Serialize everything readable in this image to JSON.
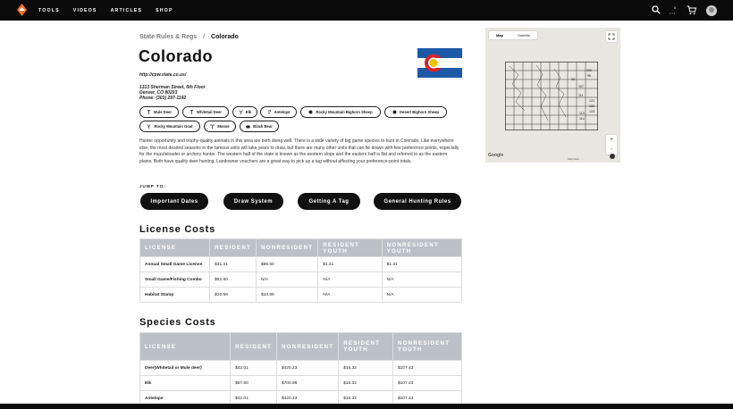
{
  "nav": {
    "links": [
      "TOOLS",
      "VIDEOS",
      "ARTICLES",
      "SHOP"
    ],
    "cart_count": "0",
    "logo": "mountain-logo-icon",
    "search_icon": "search-icon",
    "cart_icon": "cart-icon"
  },
  "breadcrumb": {
    "parent": "State Rules & Regs",
    "separator": "/",
    "current": "Colorado"
  },
  "page_title": "Colorado",
  "site_link": "http://cpw.state.co.us/",
  "address": [
    "1313 Sherman Street, 6th Floor",
    "Denver, CO 80203",
    "Phone: (303) 297-1192"
  ],
  "species_buttons": [
    {
      "label": "Mule Deer",
      "icon": "deer-icon"
    },
    {
      "label": "Whitetail Deer",
      "icon": "deer-icon"
    },
    {
      "label": "Elk",
      "icon": "elk-icon"
    },
    {
      "label": "Antelope",
      "icon": "antelope-icon"
    },
    {
      "label": "Rocky Mountain Bighorn Sheep",
      "icon": "sheep-icon"
    },
    {
      "label": "Desert Bighorn Sheep",
      "icon": "sheep-icon"
    },
    {
      "label": "Rocky Mountain Goat",
      "icon": "goat-icon"
    },
    {
      "label": "Moose",
      "icon": "moose-icon"
    },
    {
      "label": "Black Bear",
      "icon": "bear-icon"
    }
  ],
  "description": "Hunter opportunity and trophy-quality animals in this area are both doing well. There is a wide variety of big game species to hunt in Colorado. Like everywhere else, the most desired seasons in the famous units will take years to draw, but there are many other units that can be drawn with few preference points, especially for the muzzleloader or archery hunter. The western half of the state is known as the western slope and the eastern half is flat and referred to as the eastern plains. Both have quality deer hunting. Landowner vouchers are a great way to pick up a tag without affecting your preference-point totals.",
  "jump": {
    "label": "JUMP TO:",
    "buttons": [
      "Important Dates",
      "Draw System",
      "Getting A Tag",
      "General Hunting Rules"
    ]
  },
  "license_costs": {
    "title": "License Costs",
    "headers": [
      "LICENSE",
      "RESIDENT",
      "NONRESIDENT",
      "RESIDENT YOUTH",
      "NONRESIDENT YOUTH"
    ],
    "rows": [
      [
        "Annual Small Game License",
        "$31.41",
        "$86.50",
        "$1.31",
        "$1.31"
      ],
      [
        "Small Game/Fishing Combo",
        "$52.60",
        "N/A",
        "N/A",
        "N/A"
      ],
      [
        "Habitat Stamp",
        "$10.59",
        "$10.59",
        "N/A",
        "N/A"
      ]
    ]
  },
  "species_costs": {
    "title": "Species Costs",
    "headers": [
      "LICENSE",
      "RESIDENT",
      "NONRESIDENT",
      "RESIDENT YOUTH",
      "NONRESIDENT YOUTH"
    ],
    "rows": [
      [
        "Deer(Whitetail or Mule deer)",
        "$42.01",
        "$420.23",
        "$16.32",
        "$107.43"
      ],
      [
        "Elk",
        "$57.90",
        "$700.98",
        "$16.32",
        "$107.43"
      ],
      [
        "Antelope",
        "$42.01",
        "$420.23",
        "$16.32",
        "$107.43"
      ]
    ]
  },
  "map": {
    "tabs": [
      "Map",
      "Satellite"
    ],
    "zoom_in": "+",
    "zoom_out": "-",
    "google_label": "Google",
    "credit": "Map data",
    "unit_labels": [
      "100",
      "96",
      "99",
      "107",
      "111",
      "121",
      "122",
      "123",
      "113",
      "114"
    ]
  },
  "colors": {
    "nav_bg": "#0b0b0b",
    "header_cell": "#bcc1c7",
    "button_dark": "#111111",
    "flag_blue": "#1c5aa8",
    "flag_red": "#d4242b",
    "flag_gold": "#f5c400"
  }
}
